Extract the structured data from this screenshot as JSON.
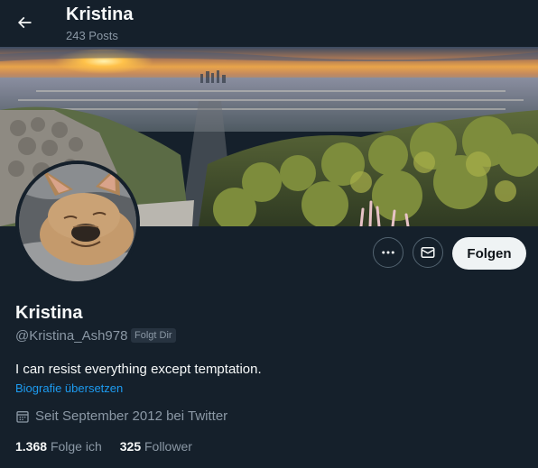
{
  "header": {
    "title": "Kristina",
    "post_count": "243 Posts",
    "back_icon": "arrow-left-icon"
  },
  "banner": {
    "description_icon": "city-sunset-banner-image"
  },
  "profile": {
    "name": "Kristina",
    "handle": "@Kristina_Ash978",
    "follows_you_badge": "Folgt Dir",
    "bio": "I can resist everything except temptation.",
    "translate_bio": "Biografie übersetzen",
    "joined": "Seit September 2012 bei Twitter"
  },
  "actions": {
    "more_icon": "more-icon",
    "message_icon": "envelope-icon",
    "follow_label": "Folgen"
  },
  "stats": {
    "following_count": "1.368",
    "following_label": "Folge ich",
    "followers_count": "325",
    "followers_label": "Follower"
  },
  "colors": {
    "background": "#15202b",
    "primary_text": "#f7f9f9",
    "secondary_text": "#8b98a5",
    "link": "#1d9bf0",
    "follow_button_bg": "#eff3f4"
  }
}
